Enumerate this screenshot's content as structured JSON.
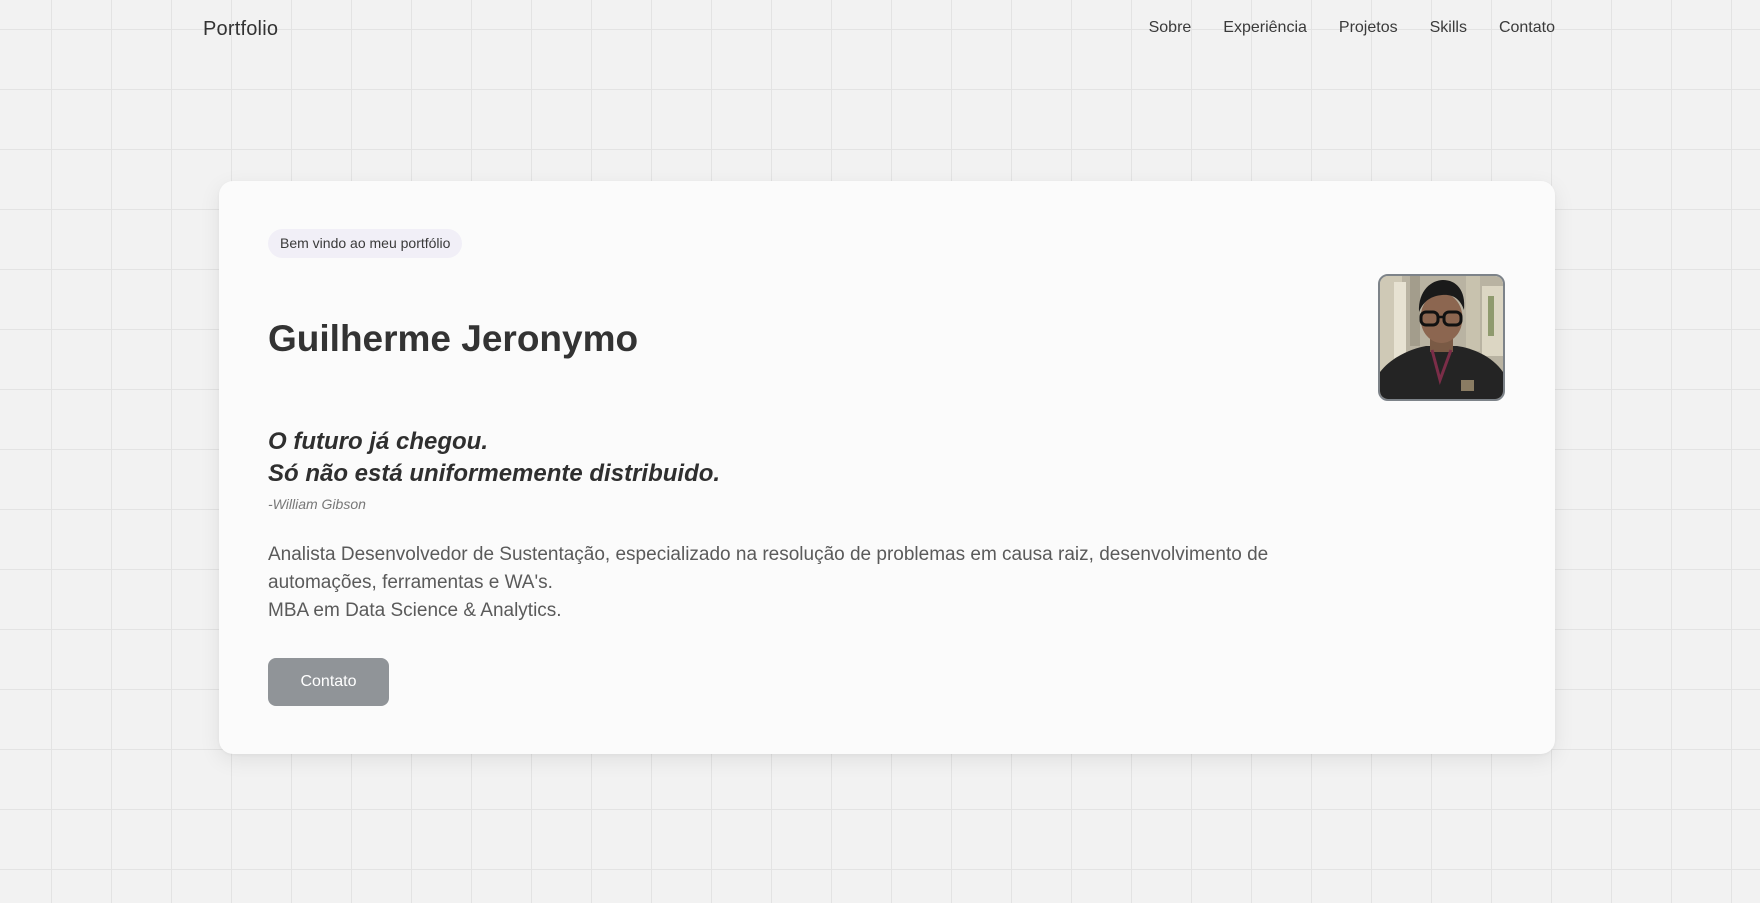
{
  "header": {
    "brand": "Portfolio",
    "nav": [
      {
        "label": "Sobre"
      },
      {
        "label": "Experiência"
      },
      {
        "label": "Projetos"
      },
      {
        "label": "Skills"
      },
      {
        "label": "Contato"
      }
    ]
  },
  "hero": {
    "badge": "Bem vindo ao meu portfólio",
    "name": "Guilherme Jeronymo",
    "quote": {
      "line1": "O futuro já chegou.",
      "line2": "Só não está uniformemente distribuido.",
      "author": "-William Gibson"
    },
    "description": {
      "line1": "Analista Desenvolvedor de Sustentação, especializado na resolução de problemas em causa raiz, desenvolvimento de automações, ferramentas e WA's.",
      "line2": "MBA em Data Science & Analytics."
    },
    "cta_label": "Contato",
    "avatar_icon": "profile-photo"
  },
  "colors": {
    "page_background": "#f2f2f2",
    "card_background": "#fbfbfb",
    "badge_background": "#f1eff7",
    "button_background": "#909498",
    "text_primary": "#333333",
    "text_secondary": "#5a5a5a"
  }
}
